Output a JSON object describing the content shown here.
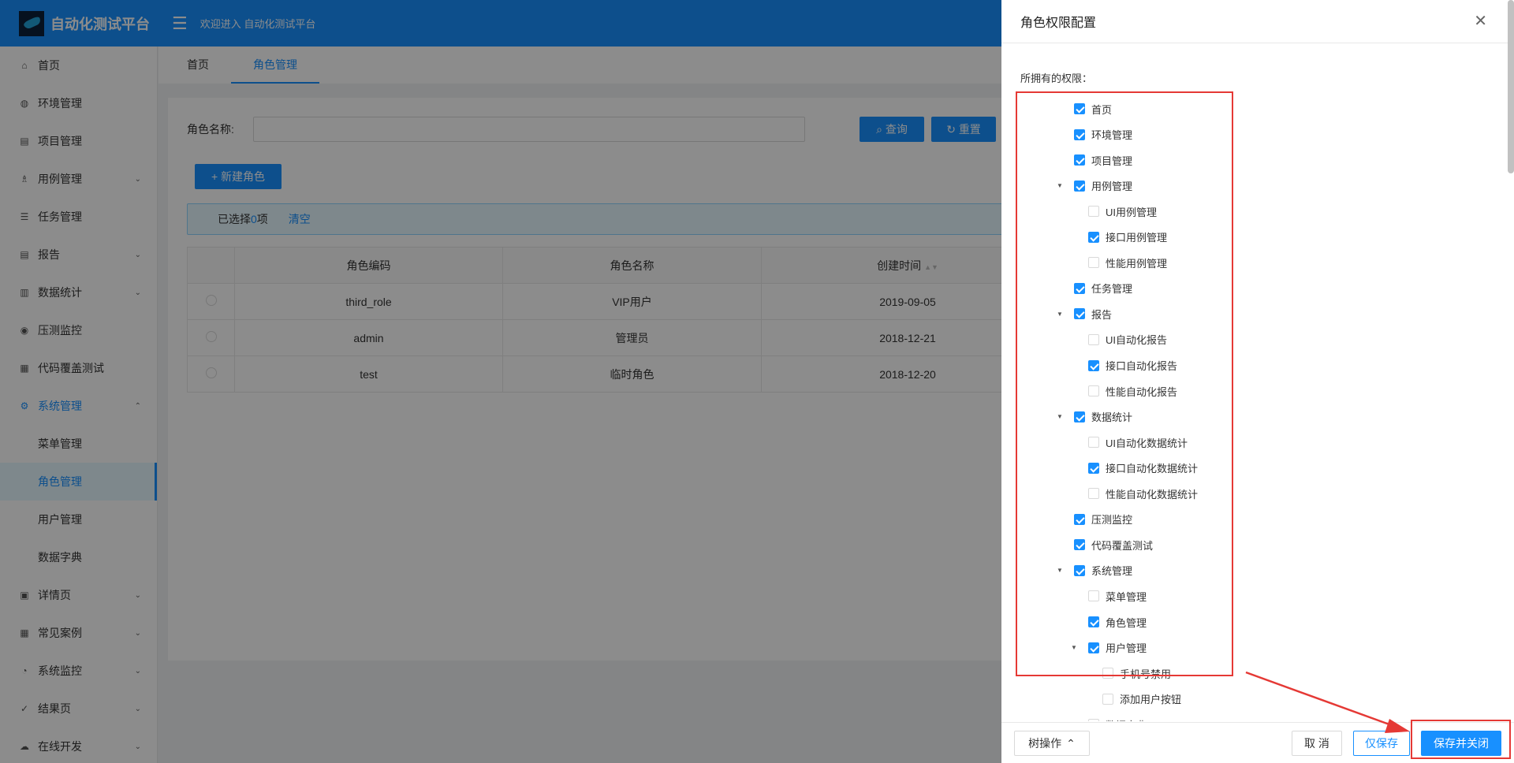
{
  "header": {
    "app_name": "自动化测试平台",
    "welcome": "欢迎进入 自动化测试平台"
  },
  "sidebar": {
    "items": [
      {
        "label": "首页",
        "icon": "home-icon"
      },
      {
        "label": "环境管理",
        "icon": "globe-icon"
      },
      {
        "label": "项目管理",
        "icon": "project-icon"
      },
      {
        "label": "用例管理",
        "icon": "cluster-icon",
        "expandable": true
      },
      {
        "label": "任务管理",
        "icon": "list-icon"
      },
      {
        "label": "报告",
        "icon": "report-icon",
        "expandable": true
      },
      {
        "label": "数据统计",
        "icon": "chart-icon",
        "expandable": true
      },
      {
        "label": "压测监控",
        "icon": "eye-icon"
      },
      {
        "label": "代码覆盖测试",
        "icon": "dashboard-icon"
      },
      {
        "label": "系统管理",
        "icon": "gear-icon",
        "expanded": true
      },
      {
        "label": "菜单管理",
        "sub": true
      },
      {
        "label": "角色管理",
        "sub": true,
        "active": true
      },
      {
        "label": "用户管理",
        "sub": true
      },
      {
        "label": "数据字典",
        "sub": true
      },
      {
        "label": "详情页",
        "icon": "profile-icon",
        "expandable": true
      },
      {
        "label": "常见案例",
        "icon": "appstore-icon",
        "expandable": true
      },
      {
        "label": "系统监控",
        "icon": "monitor-icon",
        "expandable": true
      },
      {
        "label": "结果页",
        "icon": "check-circle-icon",
        "expandable": true
      },
      {
        "label": "在线开发",
        "icon": "cloud-icon",
        "expandable": true
      }
    ]
  },
  "tabs": [
    {
      "label": "首页"
    },
    {
      "label": "角色管理",
      "active": true
    }
  ],
  "search": {
    "label": "角色名称:",
    "value": "",
    "query_label": "查询",
    "reset_label": "重置"
  },
  "toolbar": {
    "new_role_label": "新建角色"
  },
  "selection": {
    "prefix": "已选择",
    "count": "0",
    "suffix": "项",
    "clear_label": "清空"
  },
  "table": {
    "columns": [
      "角色编码",
      "角色名称",
      "创建时间"
    ],
    "rows": [
      {
        "code": "third_role",
        "name": "VIP用户",
        "created": "2019-09-05"
      },
      {
        "code": "admin",
        "name": "管理员",
        "created": "2018-12-21"
      },
      {
        "code": "test",
        "name": "临时角色",
        "created": "2018-12-20"
      }
    ]
  },
  "drawer": {
    "title": "角色权限配置",
    "perm_title": "所拥有的权限：",
    "tree": [
      {
        "label": "首页",
        "level": 0,
        "checked": true
      },
      {
        "label": "环境管理",
        "level": 0,
        "checked": true
      },
      {
        "label": "项目管理",
        "level": 0,
        "checked": true
      },
      {
        "label": "用例管理",
        "level": 0,
        "checked": true,
        "expanded": true
      },
      {
        "label": "UI用例管理",
        "level": 1,
        "checked": false
      },
      {
        "label": "接口用例管理",
        "level": 1,
        "checked": true
      },
      {
        "label": "性能用例管理",
        "level": 1,
        "checked": false
      },
      {
        "label": "任务管理",
        "level": 0,
        "checked": true
      },
      {
        "label": "报告",
        "level": 0,
        "checked": true,
        "expanded": true
      },
      {
        "label": "UI自动化报告",
        "level": 1,
        "checked": false
      },
      {
        "label": "接口自动化报告",
        "level": 1,
        "checked": true
      },
      {
        "label": "性能自动化报告",
        "level": 1,
        "checked": false
      },
      {
        "label": "数据统计",
        "level": 0,
        "checked": true,
        "expanded": true
      },
      {
        "label": "UI自动化数据统计",
        "level": 1,
        "checked": false
      },
      {
        "label": "接口自动化数据统计",
        "level": 1,
        "checked": true
      },
      {
        "label": "性能自动化数据统计",
        "level": 1,
        "checked": false
      },
      {
        "label": "压测监控",
        "level": 0,
        "checked": true
      },
      {
        "label": "代码覆盖测试",
        "level": 0,
        "checked": true
      },
      {
        "label": "系统管理",
        "level": 0,
        "checked": true,
        "expanded": true
      },
      {
        "label": "菜单管理",
        "level": 1,
        "checked": false
      },
      {
        "label": "角色管理",
        "level": 1,
        "checked": true
      },
      {
        "label": "用户管理",
        "level": 1,
        "checked": true,
        "expanded": true
      },
      {
        "label": "手机号禁用",
        "level": 2,
        "checked": false
      },
      {
        "label": "添加用户按钮",
        "level": 2,
        "checked": false
      },
      {
        "label": "数据字典",
        "level": 1,
        "checked": false
      }
    ],
    "footer": {
      "tree_ops_label": "树操作",
      "cancel_label": "取 消",
      "only_save_label": "仅保存",
      "save_close_label": "保存并关闭"
    }
  },
  "colors": {
    "primary": "#1890ff",
    "annotation": "#e53935"
  }
}
